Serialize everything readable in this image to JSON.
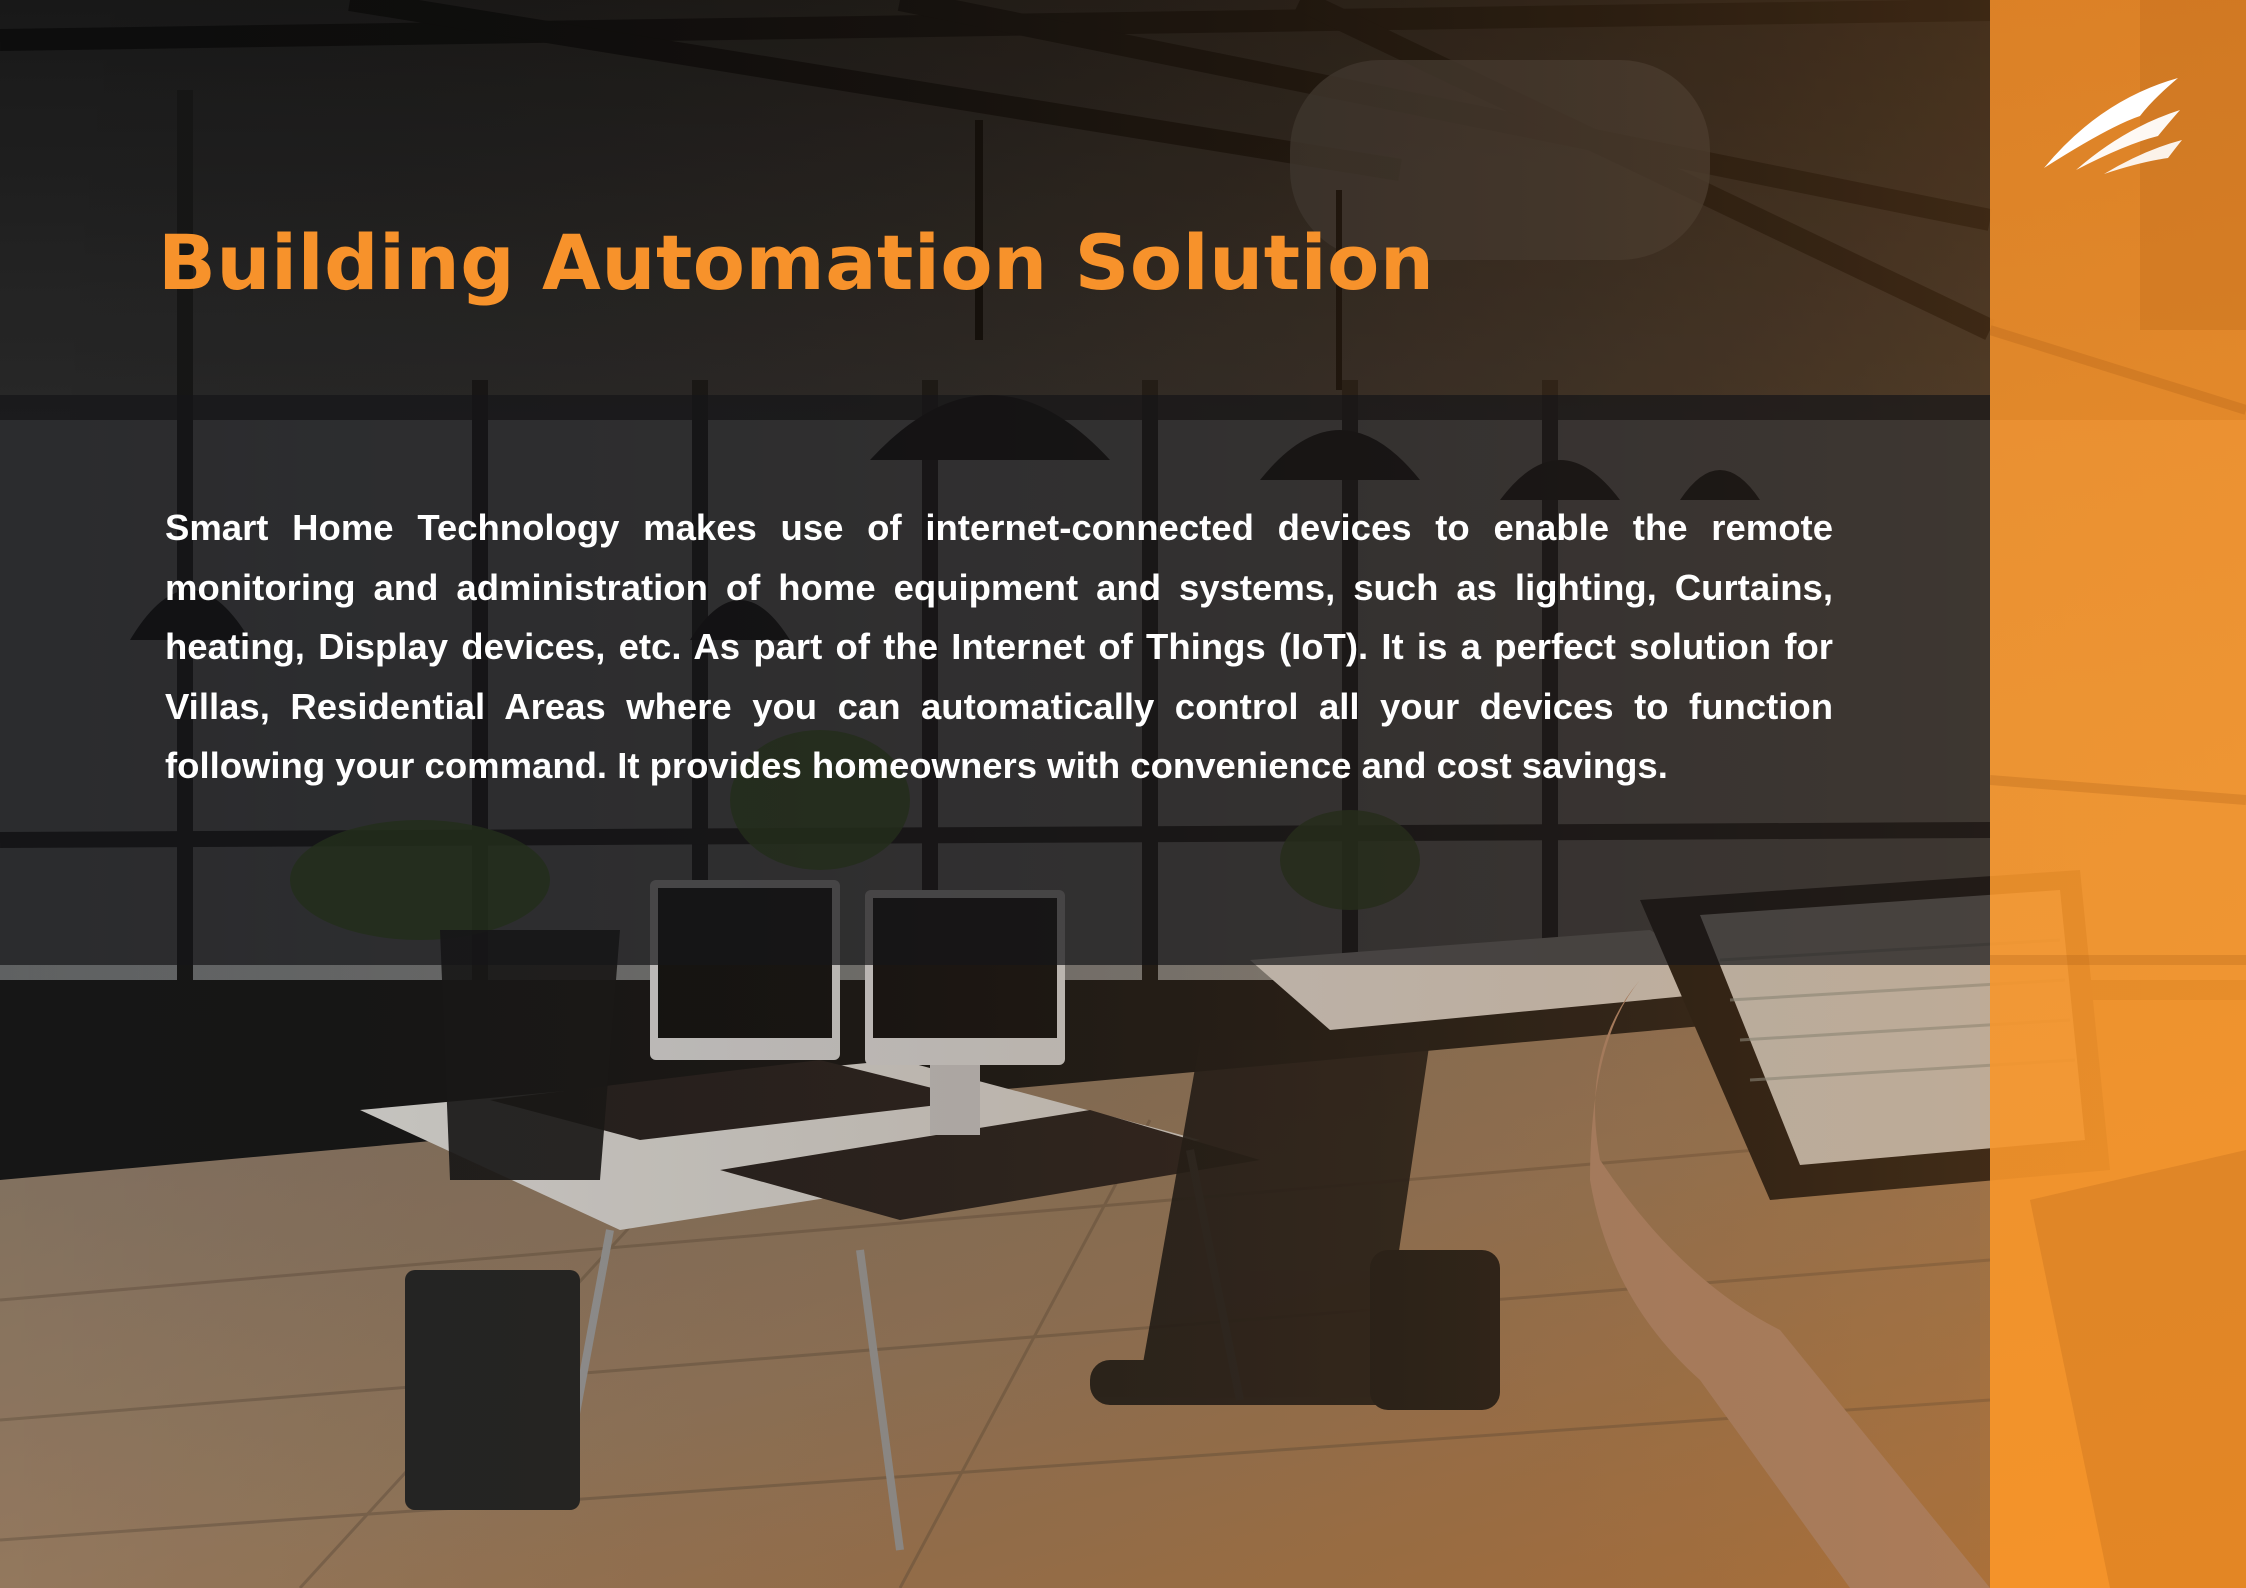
{
  "page": {
    "title": "Building Automation Solution",
    "body": "Smart Home Technology makes use of internet-connected devices to enable the remote monitoring and administration of home equipment and systems, such as lighting, Curtains, heating, Display devices, etc. As part of the Internet of Things (IoT). It is a perfect solution for Villas, Residential Areas where you can automatically control all your devices to function following your command. It provides homeowners with convenience and cost savings."
  },
  "colors": {
    "accent_orange": "#f7922b",
    "band_dark": "#161618",
    "text_white": "#ffffff"
  },
  "icons": {
    "logo": "swoosh-wing-logo"
  }
}
